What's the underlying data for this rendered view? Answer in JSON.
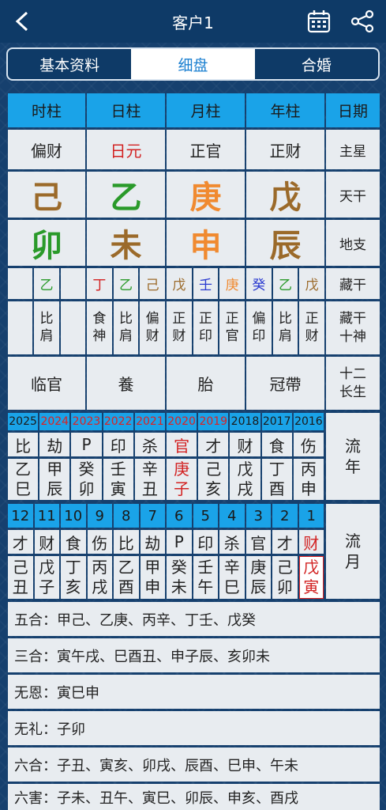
{
  "header": {
    "title": "客户1"
  },
  "tabs": [
    "基本资料",
    "细盘",
    "合婚"
  ],
  "pillars": {
    "headers": [
      "时柱",
      "日柱",
      "月柱",
      "年柱",
      "日期"
    ],
    "zhuxing": [
      "偏财",
      "日元",
      "正官",
      "正财"
    ],
    "zhuxing_label": "主星",
    "tiangan": [
      "己",
      "乙",
      "庚",
      "戊"
    ],
    "tiangan_label": "天干",
    "dizhi": [
      "卯",
      "未",
      "申",
      "辰"
    ],
    "dizhi_label": "地支",
    "canggan_label": "藏干",
    "canggan": [
      "乙",
      "丁",
      "乙",
      "己",
      "戊",
      "壬",
      "庚",
      "癸",
      "乙",
      "戊"
    ],
    "shishen_label": "藏干十神",
    "shishen": [
      "比肩",
      "食神",
      "比肩",
      "偏财",
      "正财",
      "正印",
      "正官",
      "偏印",
      "比肩",
      "正财"
    ],
    "changsheng_label": "十二长生",
    "changsheng": [
      "临官",
      "養",
      "胎",
      "冠帶"
    ]
  },
  "liunian": {
    "label": "流年",
    "years": [
      "2025",
      "2024",
      "2023",
      "2022",
      "2021",
      "2020",
      "2019",
      "2018",
      "2017",
      "2016"
    ],
    "gods": [
      "比",
      "劫",
      "P",
      "印",
      "杀",
      "官",
      "才",
      "财",
      "食",
      "伤"
    ],
    "ganzhi": [
      "乙巳",
      "甲辰",
      "癸卯",
      "壬寅",
      "辛丑",
      "庚子",
      "己亥",
      "戊戌",
      "丁酉",
      "丙申"
    ]
  },
  "liuyue": {
    "label": "流月",
    "months": [
      "12",
      "11",
      "10",
      "9",
      "8",
      "7",
      "6",
      "5",
      "4",
      "3",
      "2",
      "1"
    ],
    "gods": [
      "才",
      "财",
      "食",
      "伤",
      "比",
      "劫",
      "P",
      "印",
      "杀",
      "官",
      "才",
      "财"
    ],
    "ganzhi": [
      "己丑",
      "戊子",
      "丁亥",
      "丙戌",
      "乙酉",
      "甲申",
      "癸未",
      "壬午",
      "辛巳",
      "庚辰",
      "己卯",
      "戊寅"
    ]
  },
  "relations": [
    "五合：甲己、乙庚、丙辛、丁壬、戊癸",
    "三合：寅午戌、巳酉丑、申子辰、亥卯未",
    "无恩：寅巳申",
    "无礼：子卯",
    "六合：子丑、寅亥、卯戌、辰酉、巳申、午未",
    "六害：子未、丑午、寅巳、卯辰、申亥、酉戌"
  ],
  "colors": {
    "header_bg": "#0e3a67",
    "cell_bg": "#e8ecf0",
    "header_cell": "#1aa3e8",
    "earth": "#9b6a2a",
    "wood": "#2a9a2a",
    "metal": "#f08a30",
    "fire": "#d22222",
    "water": "#2a3ad0"
  }
}
